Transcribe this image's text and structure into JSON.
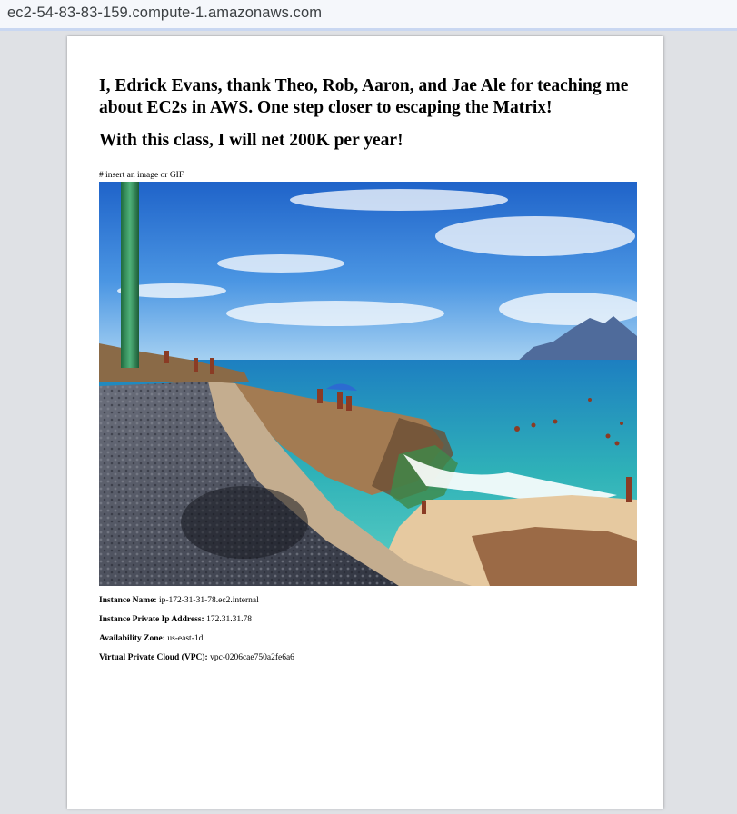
{
  "browser": {
    "url": "ec2-54-83-83-159.compute-1.amazonaws.com"
  },
  "page": {
    "heading_thanks": "I, Edrick Evans, thank Theo, Rob, Aaron, and Jae Ale for teaching me about EC2s in AWS. One step closer to escaping the Matrix!",
    "heading_goal": "With this class, I will net 200K per year!",
    "image_caption": "# insert an image or GIF",
    "image_description_icon": "beach-photo",
    "info": [
      {
        "label": "Instance Name:",
        "value": "ip-172-31-31-78.ec2.internal"
      },
      {
        "label": "Instance Private Ip Address:",
        "value": "172.31.31.78"
      },
      {
        "label": "Availability Zone:",
        "value": "us-east-1d"
      },
      {
        "label": "Virtual Private Cloud (VPC):",
        "value": "vpc-0206cae750a2fe6a6"
      }
    ]
  },
  "colors": {
    "sky": "#3f86d8",
    "sea": "#2fb2b8",
    "rock": "#b78a5c",
    "path": "#4a4f5e"
  }
}
